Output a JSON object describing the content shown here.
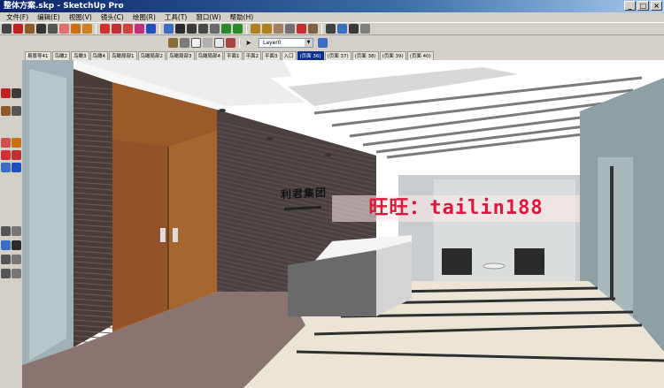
{
  "window": {
    "title": "整体方案.skp - SketchUp Pro",
    "buttons": [
      "_",
      "□",
      "×"
    ]
  },
  "menu": [
    "文件(F)",
    "编辑(E)",
    "视图(V)",
    "镜头(C)",
    "绘图(R)",
    "工具(T)",
    "窗口(W)",
    "帮助(H)"
  ],
  "layer_toolbar": {
    "current_layer": "Layer0"
  },
  "scene_tabs": [
    {
      "label": "易景导41",
      "active": false
    },
    {
      "label": "鸟瞰2",
      "active": false
    },
    {
      "label": "鸟瞰3",
      "active": false
    },
    {
      "label": "鸟瞰4",
      "active": false
    },
    {
      "label": "鸟瞰局部1",
      "active": false
    },
    {
      "label": "鸟瞰局部2",
      "active": false
    },
    {
      "label": "鸟瞰局部3",
      "active": false
    },
    {
      "label": "鸟瞰局部4",
      "active": false
    },
    {
      "label": "平面1",
      "active": false
    },
    {
      "label": "平面2",
      "active": false
    },
    {
      "label": "平面3",
      "active": false
    },
    {
      "label": "入口",
      "active": false
    },
    {
      "label": "(页面 36)",
      "active": true
    },
    {
      "label": "(页面 37)",
      "active": false
    },
    {
      "label": "(页面 38)",
      "active": false
    },
    {
      "label": "(页面 39)",
      "active": false
    },
    {
      "label": "(页面 40)",
      "active": false
    }
  ],
  "viewport": {
    "watermark": "旺旺：tailin188",
    "wall_sign": "利君集团"
  },
  "icons": {
    "toolbar1": [
      "select-arrow-icon",
      "pencil-icon",
      "rectangle-icon",
      "circle-icon",
      "arc-icon",
      "eraser-icon",
      "paint-bucket-icon",
      "push-pull-icon",
      "move-icon",
      "rotate-icon",
      "offset-icon",
      "follow-me-icon",
      "scale-icon",
      "orbit-icon",
      "pan-icon",
      "zoom-icon",
      "zoom-window-icon",
      "zoom-extents-icon",
      "previous-view-icon",
      "next-view-icon",
      "tape-measure-icon",
      "dimension-icon",
      "protractor-icon",
      "text-icon",
      "axes-icon",
      "3d-text-icon",
      "walk-icon",
      "look-around-icon",
      "position-camera-icon",
      "section-plane-icon"
    ],
    "toolbar2": [
      "iso-view-icon",
      "top-view-icon",
      "front-view-icon",
      "right-view-icon",
      "back-view-icon",
      "left-view-icon",
      "layer-arrow-icon",
      "layer-manager-icon"
    ]
  },
  "colors": {
    "title_bar": "#0a246a",
    "active_tab": "#0b2f8c",
    "watermark": "#e0163a",
    "chrome": "#d4d0c8"
  }
}
